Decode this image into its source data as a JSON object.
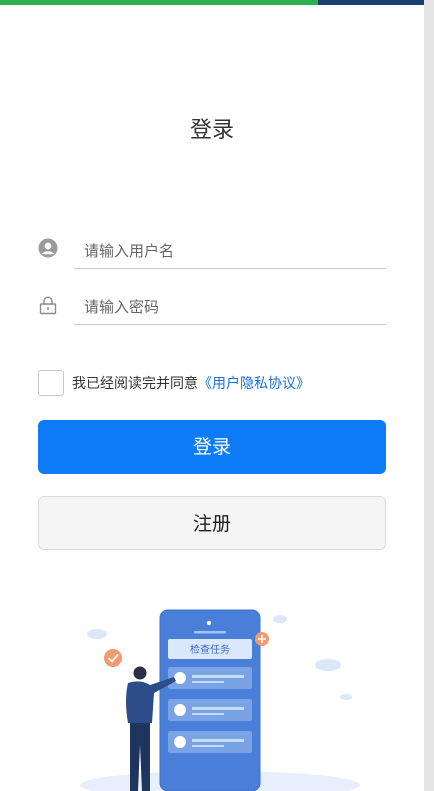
{
  "page": {
    "title": "登录",
    "colors": {
      "top_bar_green": "#2db051",
      "top_bar_navy": "#1f3d73",
      "primary": "#0f7cf7",
      "link": "#1a6fe0"
    }
  },
  "form": {
    "username": {
      "placeholder": "请输入用户名",
      "value": "",
      "icon": "user-icon"
    },
    "password": {
      "placeholder": "请输入密码",
      "value": "",
      "icon": "lock-icon"
    },
    "agreement": {
      "checked": false,
      "text": "我已经阅读完并同意",
      "link_text": "《用户隐私协议》"
    },
    "login_label": "登录",
    "register_label": "注册"
  },
  "illustration": {
    "task_label": "检查任务"
  }
}
